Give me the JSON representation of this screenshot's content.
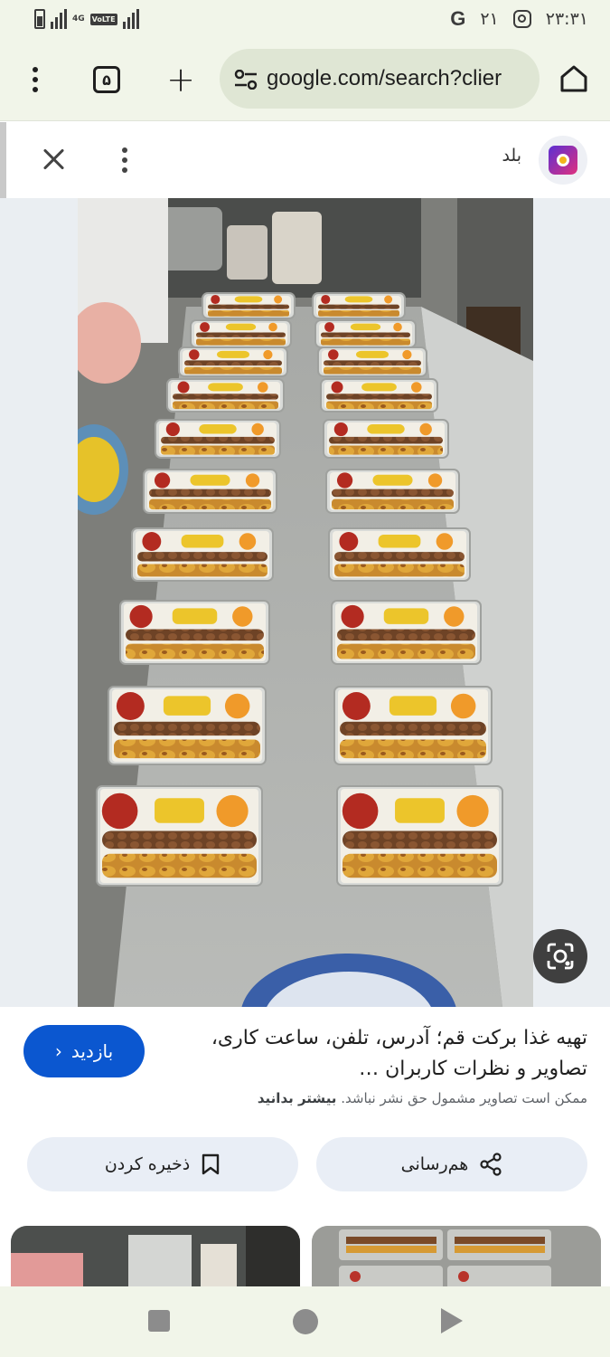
{
  "status_bar": {
    "time": "۲۳:۳۱",
    "notification_count": "۲۱",
    "network": "4G",
    "volte": "VoLTE"
  },
  "browser": {
    "url": "google.com/search?clier",
    "tab_count": "۵"
  },
  "viewer": {
    "site_name": "بلد"
  },
  "result": {
    "title": "تهیه غذا برکت قم؛ آدرس، تلفن، ساعت کاری، تصاویر و نظرات کاربران …",
    "visit_label": "بازدید",
    "copyright_text": "ممکن است تصاویر مشمول حق نشر نباشد.",
    "learn_more": "بیشتر بدانید",
    "share_label": "هم‌رسانی",
    "save_label": "ذخیره کردن"
  },
  "colors": {
    "accent": "#0b57d0",
    "chrome_background": "#f1f5e9"
  }
}
